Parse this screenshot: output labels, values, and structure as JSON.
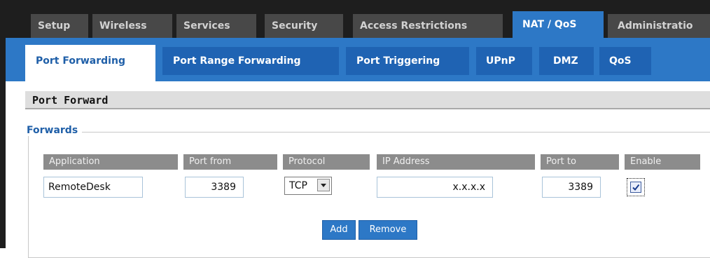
{
  "main_tabs": [
    {
      "label": "Setup"
    },
    {
      "label": "Wireless"
    },
    {
      "label": "Services"
    },
    {
      "label": "Security"
    },
    {
      "label": "Access Restrictions"
    },
    {
      "label": "NAT / QoS",
      "active": true
    },
    {
      "label": "Administratio"
    }
  ],
  "sub_tabs": [
    {
      "label": "Port Forwarding",
      "active": true
    },
    {
      "label": "Port Range Forwarding"
    },
    {
      "label": "Port Triggering"
    },
    {
      "label": "UPnP"
    },
    {
      "label": "DMZ"
    },
    {
      "label": "QoS"
    }
  ],
  "section_title": "Port Forward",
  "forwards": {
    "legend": "Forwards",
    "columns": [
      "Application",
      "Port from",
      "Protocol",
      "IP Address",
      "Port to",
      "Enable"
    ],
    "rows": [
      {
        "application": "RemoteDesk",
        "port_from": "3389",
        "protocol": "TCP",
        "ip_address": "x.x.x.x",
        "port_to": "3389",
        "enable": true
      }
    ],
    "add_label": "Add",
    "remove_label": "Remove"
  },
  "colors": {
    "dark_bg": "#1e1e1e",
    "tab_inactive": "#484848",
    "accent": "#2d78c6",
    "subtab": "#1f63b3",
    "header_gray": "#8c8c8c"
  }
}
